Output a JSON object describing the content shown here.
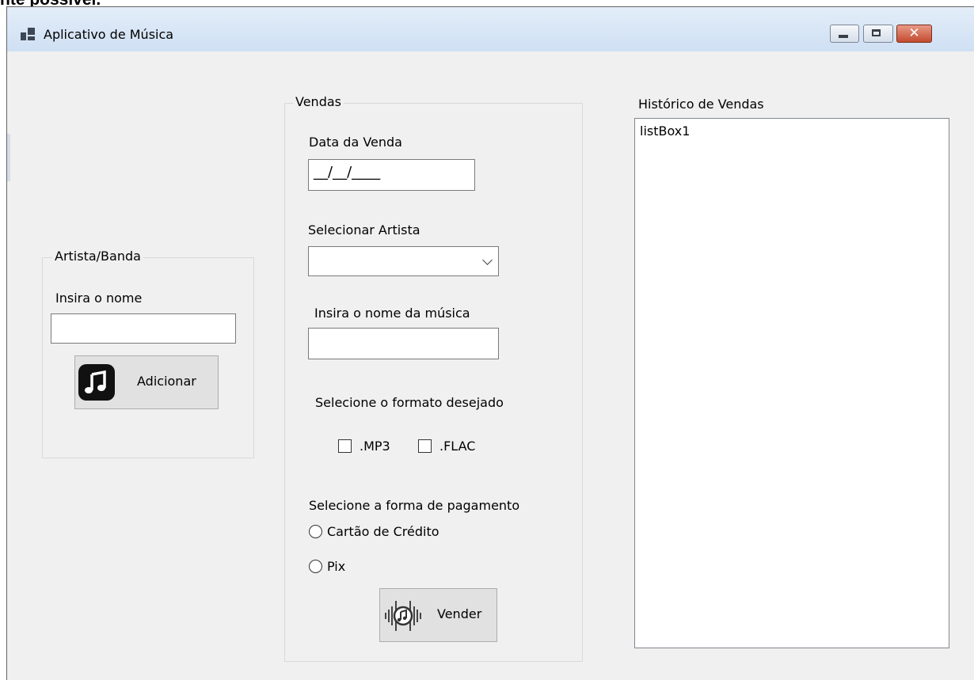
{
  "cut_heading": "nte possível.",
  "window": {
    "title": "Aplicativo de Música",
    "icon": "app-window-icon",
    "controls": [
      "minimize-icon",
      "maximize-icon",
      "close-icon"
    ],
    "close_glyph": "✕"
  },
  "artist_group": {
    "title": "Artista/Banda",
    "name_label": "Insira o nome",
    "name_value": "",
    "add_button": "Adicionar",
    "add_icon": "music-note-icon"
  },
  "sales_group": {
    "title": "Vendas",
    "date_label": "Data da Venda",
    "date_mask": "__/__/____",
    "artist_label": "Selecionar Artista",
    "artist_selected": "",
    "song_label": "Insira o nome da música",
    "song_value": "",
    "format_label": "Selecione o formato desejado",
    "formats": [
      {
        "label": ".MP3",
        "checked": false
      },
      {
        "label": ".FLAC",
        "checked": false
      }
    ],
    "payment_label": "Selecione a forma de pagamento",
    "payments": [
      {
        "label": "Cartão de Crédito",
        "selected": false
      },
      {
        "label": "Pix",
        "selected": false
      }
    ],
    "sell_button": "Vender",
    "sell_icon": "music-wave-icon"
  },
  "history": {
    "label": "Histórico de Vendas",
    "items": [
      "listBox1"
    ]
  },
  "colors": {
    "form_bg": "#f0f0f0",
    "button_bg": "#e1e1e1",
    "close_button": "#c34a2e"
  }
}
